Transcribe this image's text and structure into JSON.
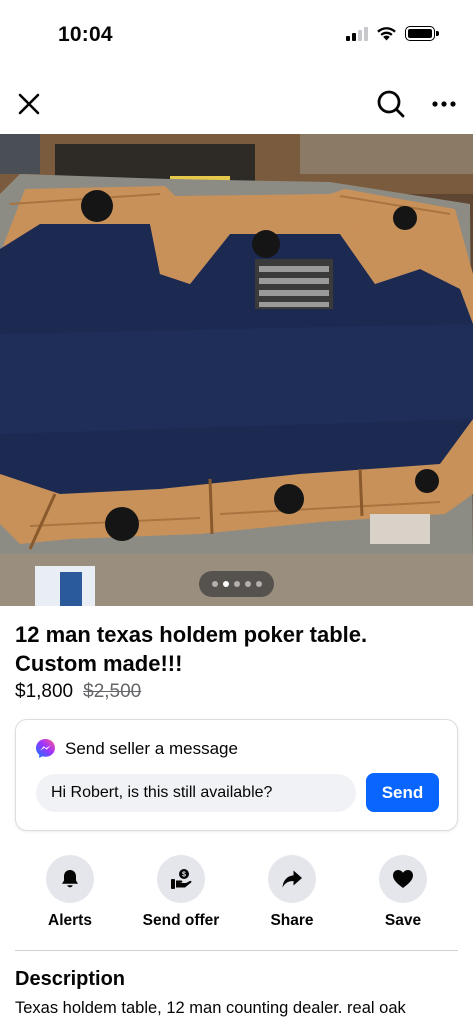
{
  "status_bar": {
    "time": "10:04"
  },
  "listing": {
    "title": "12 man texas holdem poker table. Custom made!!!",
    "price": "$1,800",
    "original_price": "$2,500",
    "photo_count": 5,
    "active_photo_index": 1
  },
  "message": {
    "heading": "Send seller a message",
    "input_value": "Hi Robert, is this still available?",
    "send_label": "Send"
  },
  "actions": [
    {
      "label": "Alerts",
      "icon": "bell-icon"
    },
    {
      "label": "Send offer",
      "icon": "send-offer-icon"
    },
    {
      "label": "Share",
      "icon": "share-icon"
    },
    {
      "label": "Save",
      "icon": "heart-icon"
    }
  ],
  "description": {
    "heading": "Description",
    "text": "Texas holdem table, 12 man counting dealer. real oak"
  },
  "colors": {
    "accent": "#0866ff",
    "felt": "#1c2a52",
    "wood": "#c9915a"
  }
}
